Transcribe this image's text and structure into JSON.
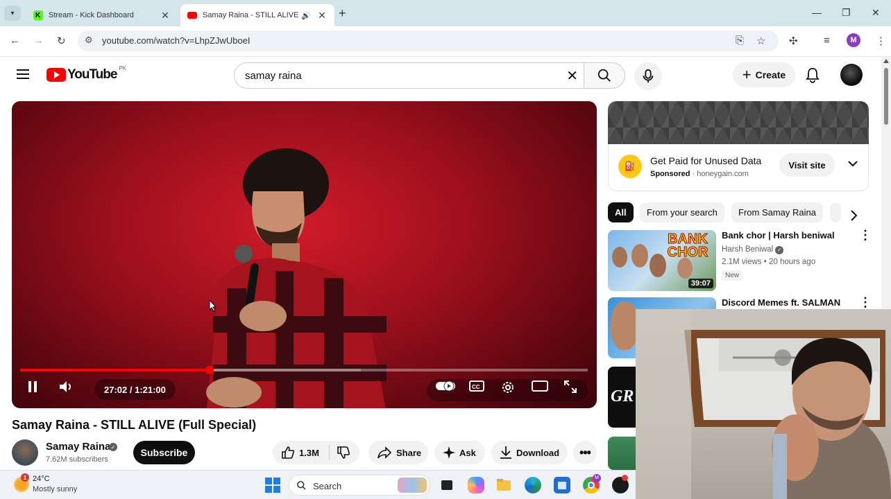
{
  "browser": {
    "tabs": [
      {
        "title": "Stream - Kick Dashboard",
        "active": false
      },
      {
        "title": "Samay Raina - STILL ALIVE (",
        "active": true
      }
    ],
    "url": "youtube.com/watch?v=LhpZJwUboeI",
    "profile_initial": "M"
  },
  "yt": {
    "country_code": "PK",
    "search_query": "samay raina",
    "create_label": "Create"
  },
  "player": {
    "time_label": "27:02 / 1:21:00",
    "progress_fraction": 0.334
  },
  "video": {
    "title": "Samay Raina - STILL ALIVE (Full Special)",
    "channel": "Samay Raina",
    "subscribers": "7.62M subscribers",
    "subscribe_label": "Subscribe",
    "likes": "1.3M",
    "share_label": "Share",
    "ask_label": "Ask",
    "download_label": "Download"
  },
  "ad": {
    "title": "Get Paid for Unused Data",
    "sponsored": "Sponsored",
    "domain": "honeygain.com",
    "cta": "Visit site"
  },
  "chips": [
    "All",
    "From your search",
    "From Samay Raina"
  ],
  "recommendations": [
    {
      "title": "Bank chor | Harsh beniwal",
      "channel": "Harsh Beniwal",
      "views": "2.1M views",
      "age": "20 hours ago",
      "badge": "New",
      "duration": "39:07",
      "thumb_text": "BANK CHOR"
    },
    {
      "title": "Discord Memes ft. SALMAN"
    },
    {
      "thumb_text": "GR"
    }
  ],
  "taskbar": {
    "weather_badge": "1",
    "temperature": "24°C",
    "condition": "Mostly sunny",
    "search_label": "Search"
  },
  "colors": {
    "yt_red": "#ff0000",
    "tabstrip": "#d4e6ec",
    "chip_active": "#0f0f0f",
    "ad_logo": "#ffc815"
  }
}
